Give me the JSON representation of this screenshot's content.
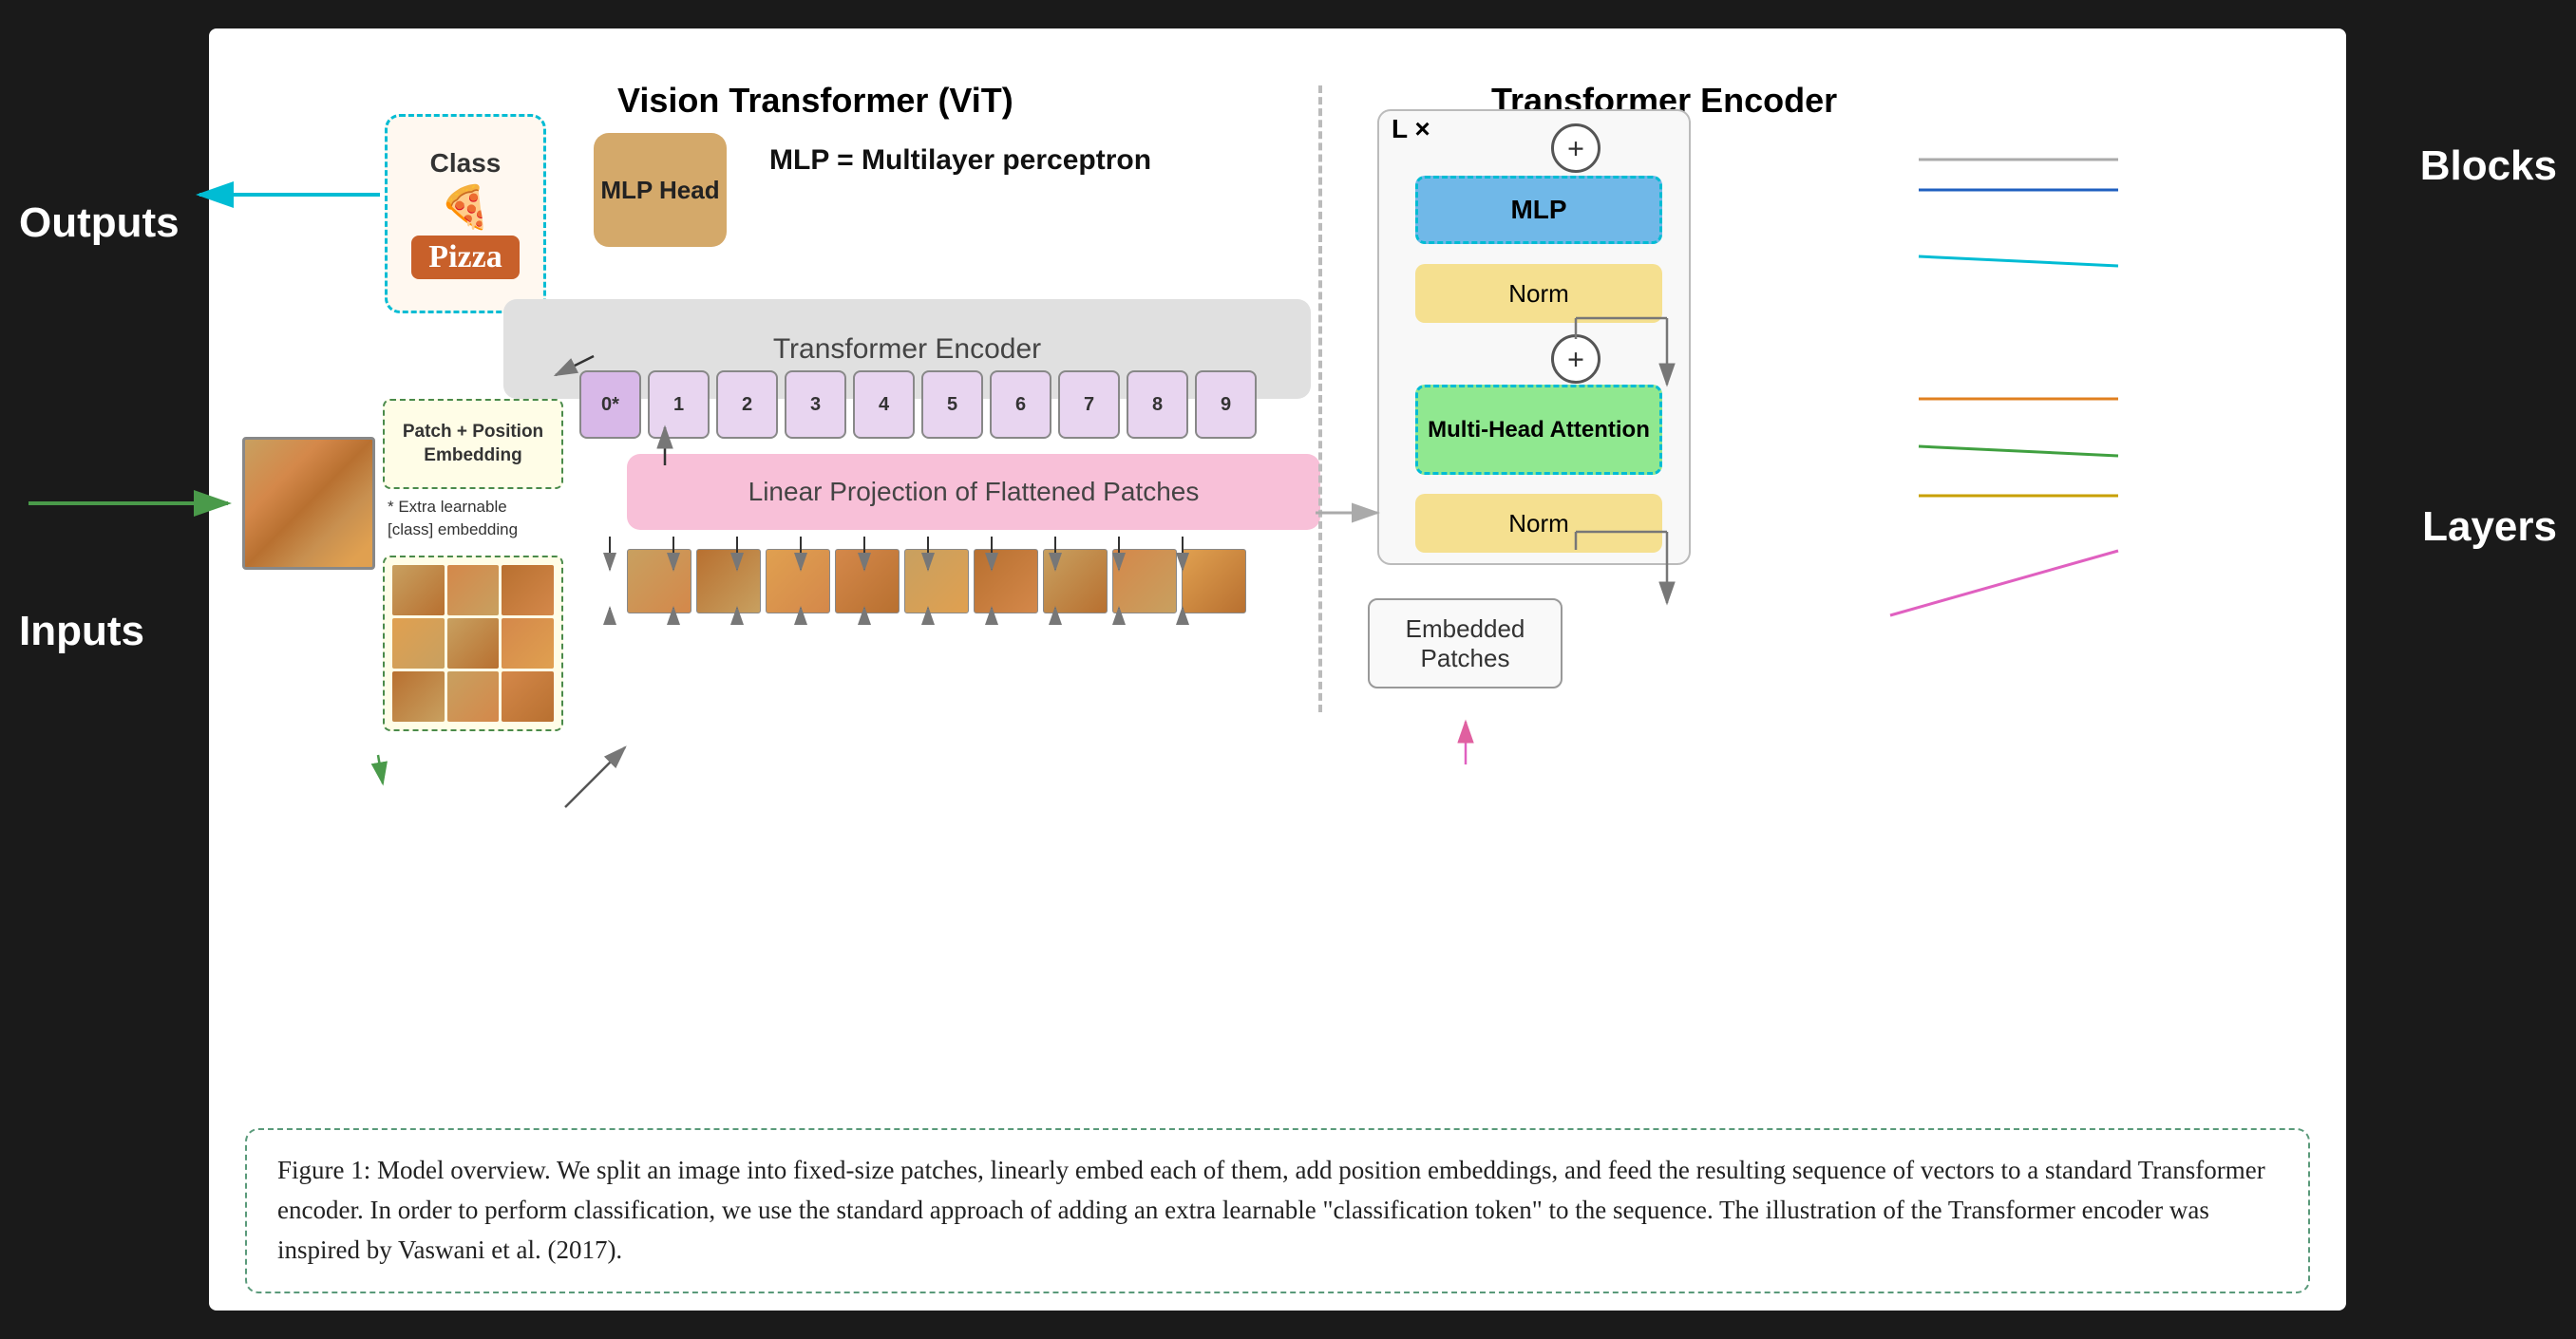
{
  "page": {
    "background": "#1a1a1a",
    "labels": {
      "outputs": "Outputs",
      "inputs": "Inputs",
      "blocks": "Blocks",
      "layers": "Layers"
    },
    "vit_title": "Vision Transformer (ViT)",
    "te_title": "Transformer Encoder",
    "mlp_eq": "MLP = Multilayer perceptron",
    "class_label": "Class",
    "pizza_label": "Pizza",
    "mlp_head": "MLP Head",
    "transformer_encoder_box": "Transformer Encoder",
    "patch_pos": "Patch + Position Embedding",
    "extra_note": "* Extra learnable\n[class] embedding",
    "linear_proj": "Linear Projection of Flattened Patches",
    "tokens": [
      "0*",
      "1",
      "2",
      "3",
      "4",
      "5",
      "6",
      "7",
      "8",
      "9"
    ],
    "rp_mlp": "MLP",
    "rp_norm1": "Norm",
    "rp_norm2": "Norm",
    "rp_mha": "Multi-Head Attention",
    "lx": "L ×",
    "embedded_patches": "Embedded Patches",
    "caption": "Figure 1: Model overview. We split an image into fixed-size patches, linearly embed each of them, add position embeddings, and feed the resulting sequence of vectors to a standard Transformer encoder. In order to perform classification, we use the standard approach of adding an extra learnable \"classification token\" to the sequence. The illustration of the Transformer encoder was inspired by Vaswani et al. (2017)."
  }
}
